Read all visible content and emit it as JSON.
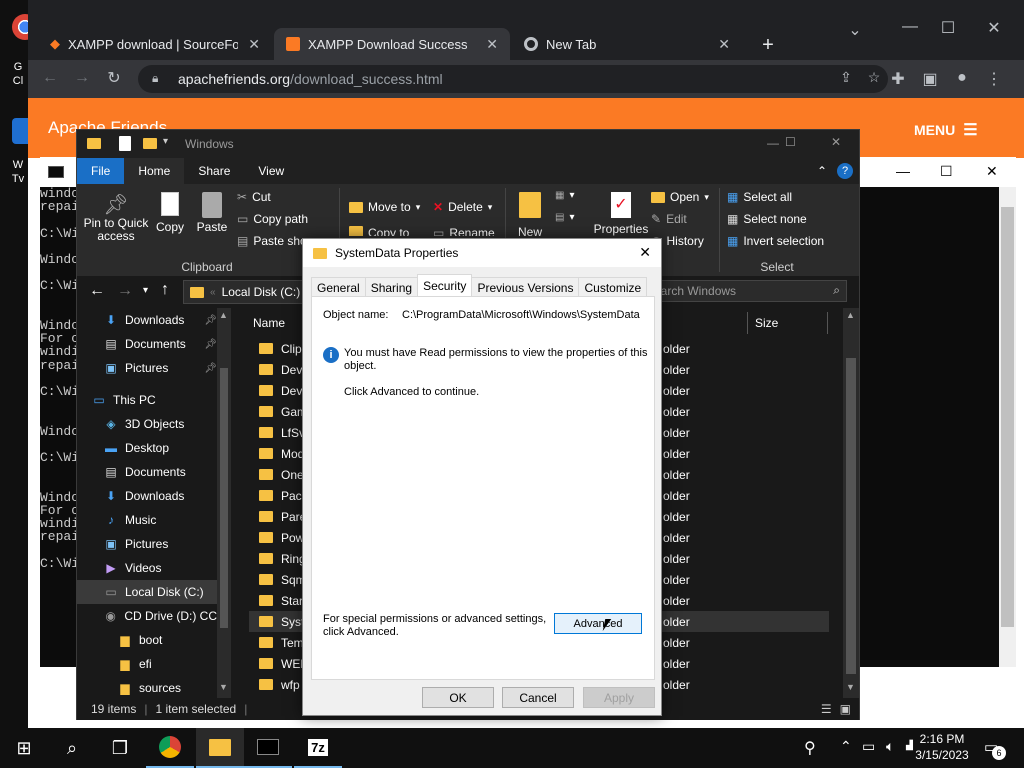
{
  "desktop": {
    "icons": [
      {
        "label": "G\nCl"
      },
      {
        "label": "W\nTv"
      }
    ]
  },
  "browser": {
    "tabs": [
      {
        "label": "XAMPP download | SourceForge"
      },
      {
        "label": "XAMPP Download Success",
        "active": true
      },
      {
        "label": "New Tab"
      }
    ],
    "address": {
      "host": "apachefriends.org",
      "path": "/download_success.html"
    },
    "site": {
      "brand": "Apache Friends",
      "menu_label": "MENU"
    },
    "colors": {
      "tabbar": "#202124",
      "site_bar": "#fb7a24"
    }
  },
  "cmd": {
    "lines": [
      "windo",
      "repai",
      "",
      "C:\\Wi",
      "",
      "Windo",
      "",
      "C:\\Wi",
      "",
      "",
      "Windo",
      "For c",
      "windi",
      "repai",
      "",
      "C:\\Wi",
      "",
      "",
      "Windo",
      "",
      "C:\\Wi",
      "",
      "",
      "Windo",
      "For c",
      "windi",
      "repai",
      "",
      "C:\\Wi"
    ]
  },
  "explorer": {
    "title": "Windows",
    "ribbon_tabs": [
      "File",
      "Home",
      "Share",
      "View"
    ],
    "clipboard": {
      "pin_label": "Pin to Quick access",
      "copy_label": "Copy",
      "paste_label": "Paste",
      "cut_label": "Cut",
      "copy_path_label": "Copy path",
      "paste_shortcut_label": "Paste sho",
      "group_label": "Clipboard"
    },
    "organize": {
      "move_to": "Move to",
      "delete": "Delete",
      "copy_to": "Copy to",
      "rename": "Rename"
    },
    "new_label": "New",
    "properties_label": "Properties",
    "open": {
      "open_label": "Open",
      "edit_label": "Edit",
      "history_label": "History"
    },
    "select": {
      "all": "Select all",
      "none": "Select none",
      "invert": "Invert selection",
      "group_label": "Select"
    },
    "path": "Local Disk (C:)",
    "search_placeholder": "earch Windows",
    "nav_items": [
      {
        "label": "Downloads",
        "icon": "download-icon",
        "pinned": true
      },
      {
        "label": "Documents",
        "icon": "document-icon",
        "pinned": true
      },
      {
        "label": "Pictures",
        "icon": "picture-icon",
        "pinned": true
      },
      {
        "label": "This PC",
        "icon": "pc-icon"
      },
      {
        "label": "3D Objects",
        "icon": "cube-icon"
      },
      {
        "label": "Desktop",
        "icon": "desktop-icon"
      },
      {
        "label": "Documents",
        "icon": "document-icon"
      },
      {
        "label": "Downloads",
        "icon": "download-icon"
      },
      {
        "label": "Music",
        "icon": "music-icon"
      },
      {
        "label": "Pictures",
        "icon": "picture-icon"
      },
      {
        "label": "Videos",
        "icon": "video-icon"
      },
      {
        "label": "Local Disk (C:)",
        "icon": "drive-icon",
        "selected": true
      },
      {
        "label": "CD Drive (D:) CC",
        "icon": "cd-icon"
      },
      {
        "label": "boot",
        "icon": "folder-icon"
      },
      {
        "label": "efi",
        "icon": "folder-icon"
      },
      {
        "label": "sources",
        "icon": "folder-icon"
      }
    ],
    "columns": {
      "name": "Name",
      "size": "Size"
    },
    "files": [
      {
        "name": "ClipS",
        "type": "older"
      },
      {
        "name": "Devic",
        "type": "older"
      },
      {
        "name": "Devic",
        "type": "older"
      },
      {
        "name": "Game",
        "type": "older"
      },
      {
        "name": "LfSvc",
        "type": "older"
      },
      {
        "name": "Mode",
        "type": "older"
      },
      {
        "name": "OneS",
        "type": "older"
      },
      {
        "name": "Packa",
        "type": "older"
      },
      {
        "name": "Paren",
        "type": "older"
      },
      {
        "name": "Powe",
        "type": "older"
      },
      {
        "name": "Ringt",
        "type": "older"
      },
      {
        "name": "Sqm",
        "type": "older"
      },
      {
        "name": "Start",
        "type": "older"
      },
      {
        "name": "Syste",
        "type": "older",
        "selected": true
      },
      {
        "name": "Temp",
        "type": "older"
      },
      {
        "name": "WER",
        "type": "older"
      },
      {
        "name": "wfp",
        "type": "older"
      }
    ],
    "status": {
      "count": "19 items",
      "selected": "1 item selected"
    }
  },
  "dialog": {
    "title": "SystemData Properties",
    "tabs": [
      "General",
      "Sharing",
      "Security",
      "Previous Versions",
      "Customize"
    ],
    "selected_tab": "Security",
    "object_name_label": "Object name:",
    "object_name_value": "C:\\ProgramData\\Microsoft\\Windows\\SystemData",
    "info_line1": "You must have Read permissions to view the properties of this",
    "info_line2": "object.",
    "continue_text": "Click Advanced to continue.",
    "special_line1": "For special permissions or advanced settings,",
    "special_line2": "click Advanced.",
    "advanced_label": "Advanced",
    "ok_label": "OK",
    "cancel_label": "Cancel",
    "apply_label": "Apply"
  },
  "taskbar": {
    "time": "2:16 PM",
    "date": "3/15/2023",
    "notification_count": "6",
    "sevenzip_label": "7z"
  }
}
